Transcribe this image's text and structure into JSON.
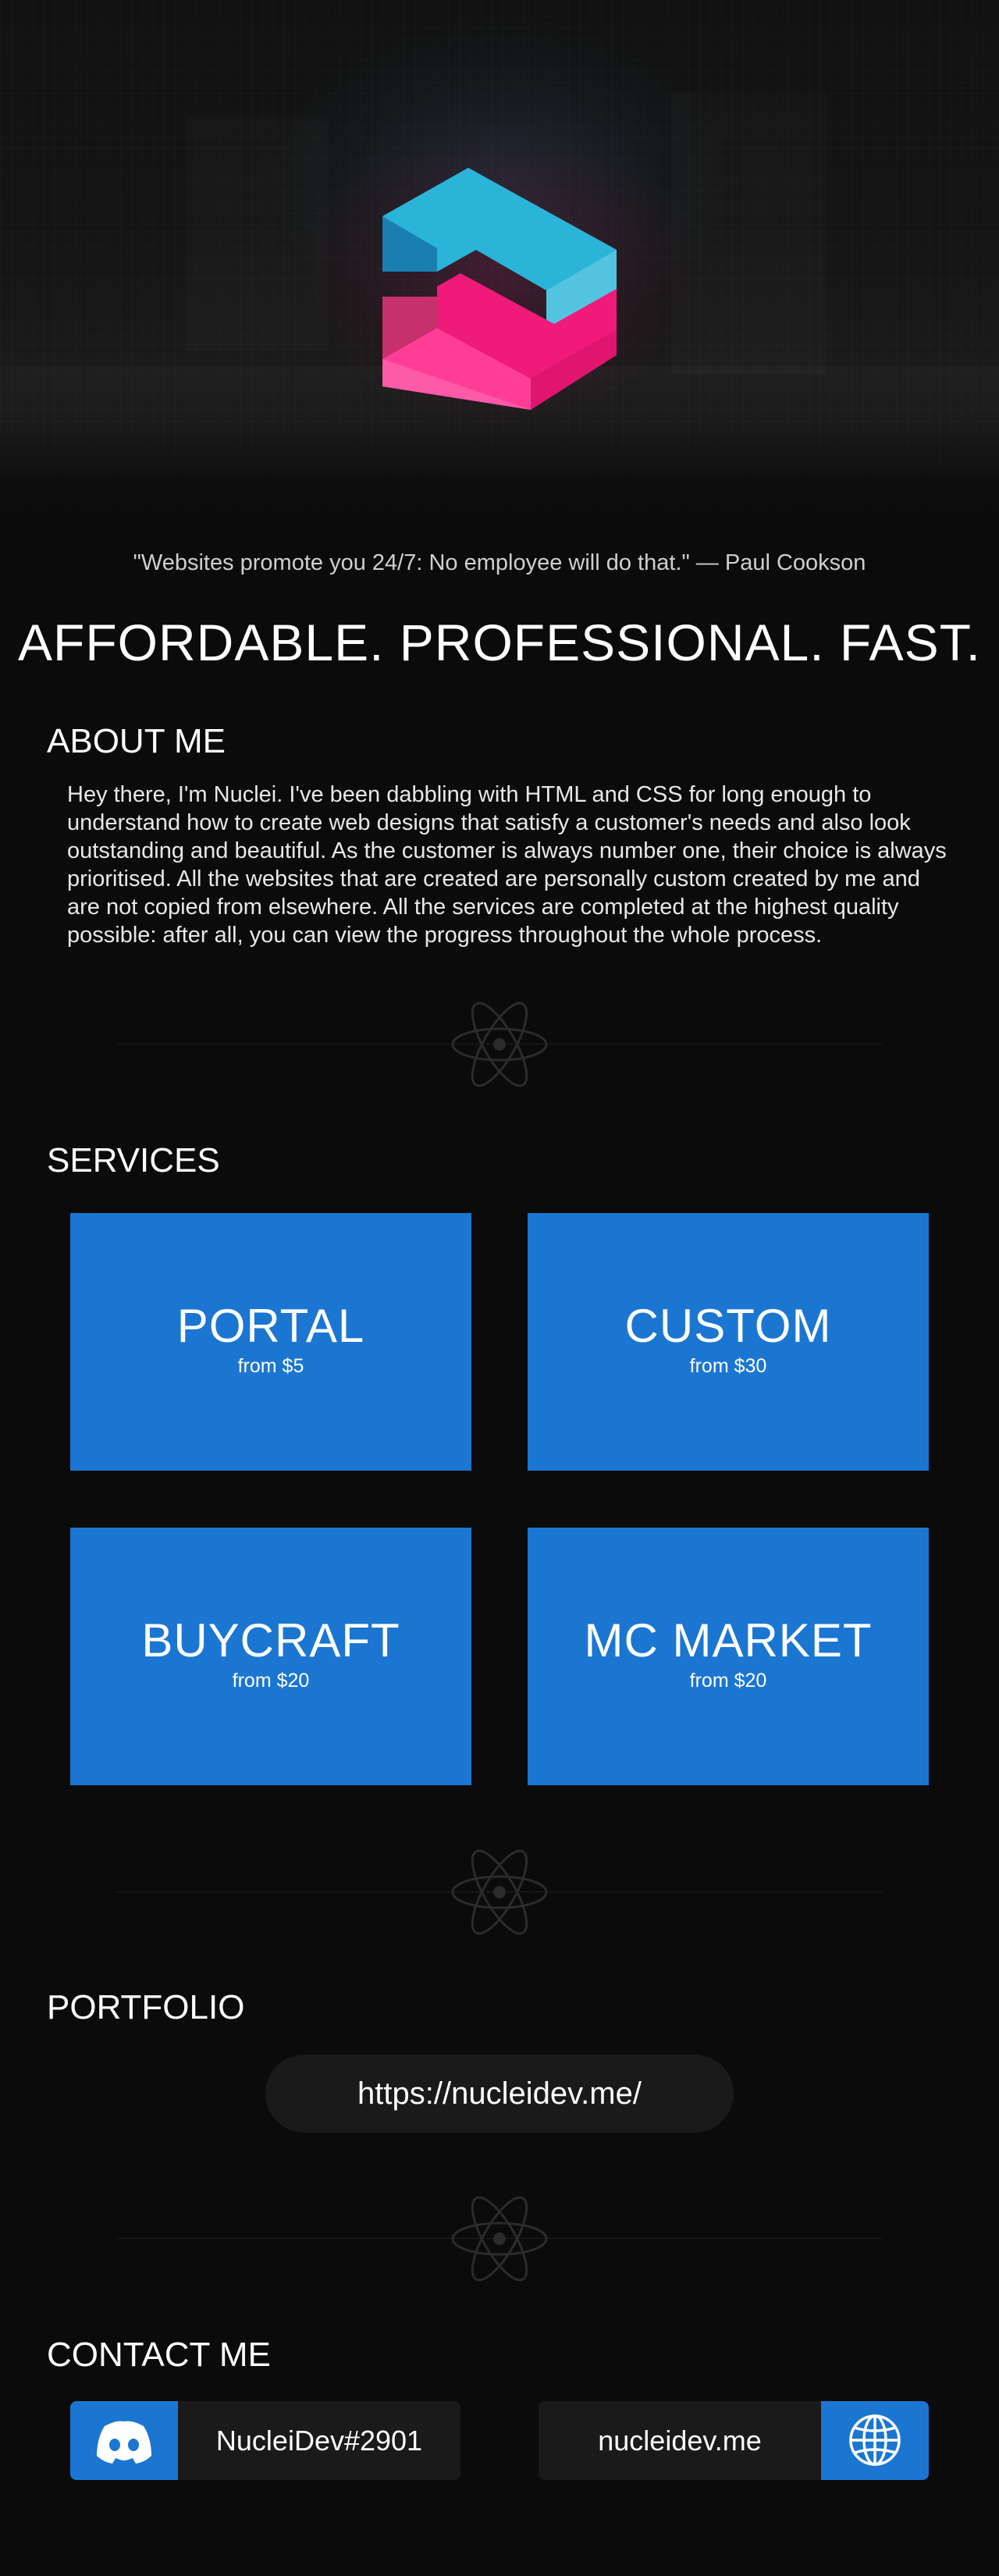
{
  "hero": {
    "logo_icon": "nuclei-logo-icon",
    "colors": {
      "blue_top": "#2ab4d8",
      "blue_front": "#1e8fc4",
      "blue_side": "#53c3e0",
      "pink_top": "#ff3d97",
      "pink_front": "#f01a7b",
      "pink_side": "#c6306d"
    }
  },
  "quote": "\"Websites promote you 24/7: No employee will do that.\" — Paul Cookson",
  "tagline": "AFFORDABLE. PROFESSIONAL. FAST.",
  "about": {
    "title": "ABOUT ME",
    "text": "Hey there, I'm Nuclei. I've been dabbling with HTML and CSS for long enough to understand how to create web designs that satisfy a customer's needs and also look outstanding and beautiful. As the customer is always number one, their choice is always prioritised. All the websites that are created are personally custom created by me and are not copied from elsewhere. All the services are completed at the highest quality possible: after all, you can view the progress throughout the whole process."
  },
  "divider_icon": "atom-icon",
  "services": {
    "title": "SERVICES",
    "accent": "#1b76d2",
    "items": [
      {
        "name": "PORTAL",
        "price": "from $5"
      },
      {
        "name": "CUSTOM",
        "price": "from $30"
      },
      {
        "name": "BUYCRAFT",
        "price": "from $20"
      },
      {
        "name": "MC MARKET",
        "price": "from $20"
      }
    ]
  },
  "portfolio": {
    "title": "PORTFOLIO",
    "link": "https://nucleidev.me/"
  },
  "contact": {
    "title": "CONTACT ME",
    "discord": {
      "icon": "discord-icon",
      "label": "NucleiDev#2901"
    },
    "website": {
      "icon": "globe-icon",
      "label": "nucleidev.me"
    }
  }
}
